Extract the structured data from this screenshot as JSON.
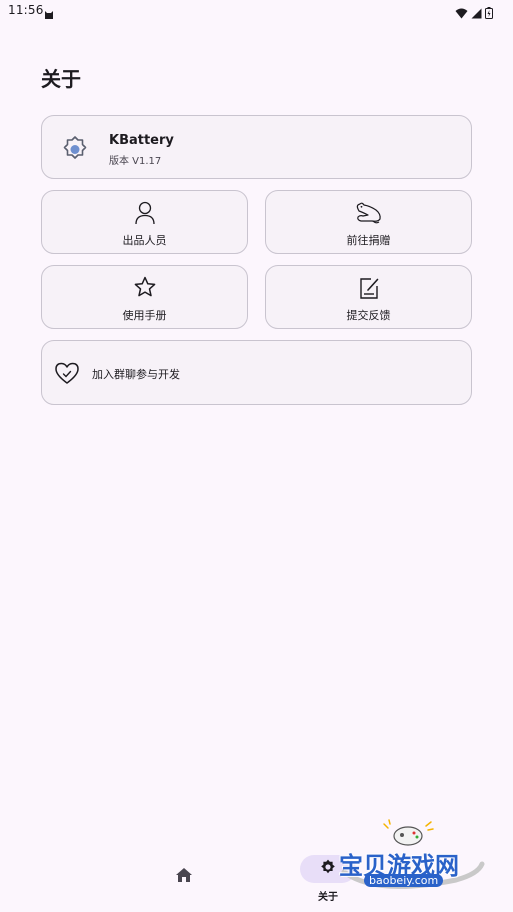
{
  "status_bar": {
    "time": "11:56"
  },
  "page": {
    "title": "关于"
  },
  "app_card": {
    "name": "KBattery",
    "version": "版本 V1.17"
  },
  "grid": [
    {
      "label": "出品人员",
      "icon": "person-icon"
    },
    {
      "label": "前往捐赠",
      "icon": "seal-icon"
    },
    {
      "label": "使用手册",
      "icon": "star-icon"
    },
    {
      "label": "提交反馈",
      "icon": "edit-note-icon"
    }
  ],
  "join_card": {
    "label": "加入群聊参与开发",
    "icon": "heart-check-icon"
  },
  "bottom_nav": {
    "home_icon": "home-icon",
    "about_icon": "gear-icon",
    "about_label": "关于"
  },
  "watermark": {
    "title": "宝贝游戏网",
    "url": "baobeiy.com"
  },
  "colors": {
    "background": "#fcf6fd",
    "card": "#f7f2f8",
    "card_border": "#c9c4cf",
    "nav_indicator": "#e8def8",
    "icon_accent": "#6e8fcf"
  }
}
